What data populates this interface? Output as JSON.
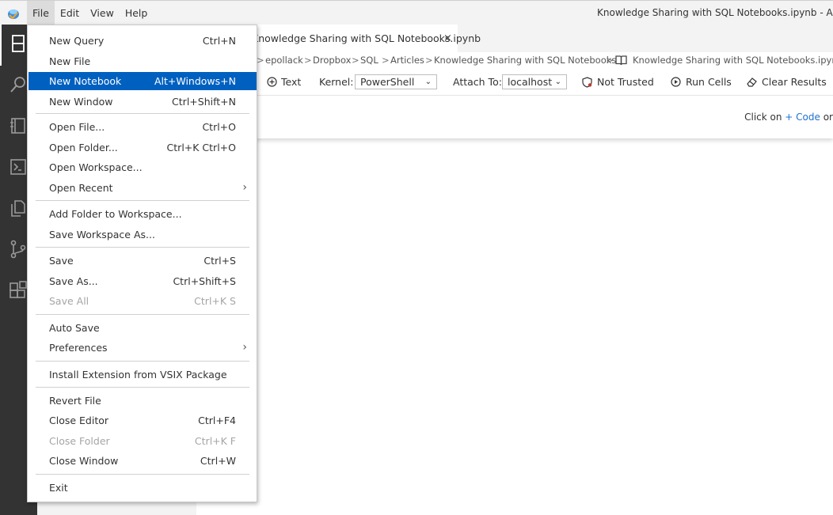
{
  "menubar": {
    "items": [
      "File",
      "Edit",
      "View",
      "Help"
    ],
    "window_title": "Knowledge Sharing with SQL Notebooks.ipynb - Az"
  },
  "editor": {
    "tab_label": "Knowledge Sharing with SQL Notebooks.ipynb",
    "tab_close": "×",
    "breadcrumb": [
      "epollack",
      "Dropbox",
      "SQL",
      "Articles",
      "Knowledge Sharing with SQL Notebooks",
      "Knowledge Sharing with SQL Notebooks.ipynb"
    ],
    "toolbar": {
      "text_label": "Text",
      "kernel_label": "Kernel:",
      "kernel_value": "PowerShell",
      "attach_label": "Attach To:",
      "attach_value": "localhost",
      "trust_label": "Not Trusted",
      "run_label": "Run Cells",
      "clear_label": "Clear Results"
    },
    "cell_hint": {
      "prefix": "Click on",
      "link": "+ Code",
      "suffix": "or"
    }
  },
  "file_menu": {
    "groups": [
      [
        {
          "label": "New Query",
          "shortcut": "Ctrl+N"
        },
        {
          "label": "New File",
          "shortcut": ""
        },
        {
          "label": "New Notebook",
          "shortcut": "Alt+Windows+N",
          "highlighted": true
        },
        {
          "label": "New Window",
          "shortcut": "Ctrl+Shift+N"
        }
      ],
      [
        {
          "label": "Open File...",
          "shortcut": "Ctrl+O"
        },
        {
          "label": "Open Folder...",
          "shortcut": "Ctrl+K Ctrl+O"
        },
        {
          "label": "Open Workspace...",
          "shortcut": ""
        },
        {
          "label": "Open Recent",
          "shortcut": "",
          "submenu": true
        }
      ],
      [
        {
          "label": "Add Folder to Workspace...",
          "shortcut": ""
        },
        {
          "label": "Save Workspace As...",
          "shortcut": ""
        }
      ],
      [
        {
          "label": "Save",
          "shortcut": "Ctrl+S"
        },
        {
          "label": "Save As...",
          "shortcut": "Ctrl+Shift+S"
        },
        {
          "label": "Save All",
          "shortcut": "Ctrl+K S",
          "disabled": true
        }
      ],
      [
        {
          "label": "Auto Save",
          "shortcut": ""
        },
        {
          "label": "Preferences",
          "shortcut": "",
          "submenu": true
        }
      ],
      [
        {
          "label": "Install Extension from VSIX Package",
          "shortcut": ""
        }
      ],
      [
        {
          "label": "Revert File",
          "shortcut": ""
        },
        {
          "label": "Close Editor",
          "shortcut": "Ctrl+F4"
        },
        {
          "label": "Close Folder",
          "shortcut": "Ctrl+K F",
          "disabled": true
        },
        {
          "label": "Close Window",
          "shortcut": "Ctrl+W"
        }
      ],
      [
        {
          "label": "Exit",
          "shortcut": ""
        }
      ]
    ]
  },
  "colors": {
    "highlight": "#0060c0",
    "activity_bar": "#333333",
    "link": "#1e6fd0"
  }
}
